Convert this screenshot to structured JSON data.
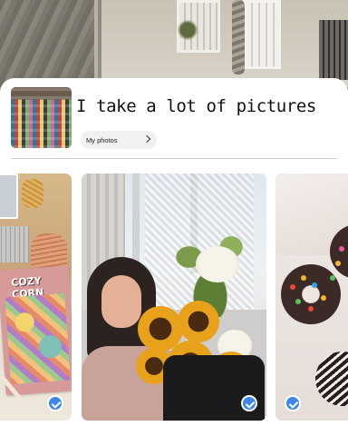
{
  "album": {
    "title": "I take a lot of pictures",
    "link_label": "My photos",
    "link_icon": "chevron-right-icon"
  },
  "photos": [
    {
      "name": "desk-with-cozy-corner-book",
      "selected": true
    },
    {
      "name": "woman-with-sunflower-bouquet",
      "selected": true
    },
    {
      "name": "box-of-chocolate-donuts",
      "selected": true
    }
  ],
  "colors": {
    "accent": "#3d87e8",
    "sheet": "#ffffff",
    "chip": "#f1f1f1",
    "divider": "#d0d0d0"
  },
  "photo_text": {
    "book_cover": "COZY CORN"
  }
}
